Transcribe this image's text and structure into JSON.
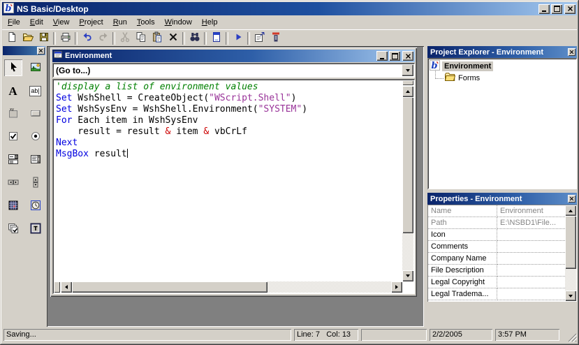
{
  "window": {
    "title": "NS Basic/Desktop",
    "logo_icon": "nsbasic-b-logo",
    "controls": [
      "minimize",
      "maximize",
      "close"
    ]
  },
  "menu": {
    "items": [
      {
        "label": "File",
        "u": 0
      },
      {
        "label": "Edit",
        "u": 0
      },
      {
        "label": "View",
        "u": 0
      },
      {
        "label": "Project",
        "u": 0
      },
      {
        "label": "Run",
        "u": 0
      },
      {
        "label": "Tools",
        "u": 0
      },
      {
        "label": "Window",
        "u": 0
      },
      {
        "label": "Help",
        "u": 0
      }
    ]
  },
  "toolbar": {
    "items": [
      {
        "name": "new",
        "enabled": true
      },
      {
        "name": "open",
        "enabled": true
      },
      {
        "name": "save",
        "enabled": true
      },
      {
        "sep": true
      },
      {
        "name": "print",
        "enabled": true
      },
      {
        "sep": true
      },
      {
        "name": "undo",
        "enabled": true
      },
      {
        "name": "redo",
        "enabled": false
      },
      {
        "sep": true
      },
      {
        "name": "cut",
        "enabled": false
      },
      {
        "name": "copy",
        "enabled": true
      },
      {
        "name": "paste",
        "enabled": true
      },
      {
        "name": "delete",
        "enabled": true
      },
      {
        "sep": true
      },
      {
        "name": "find",
        "enabled": true
      },
      {
        "sep": true
      },
      {
        "name": "deploy",
        "enabled": true
      },
      {
        "sep": true
      },
      {
        "name": "run",
        "enabled": true
      },
      {
        "sep": true
      },
      {
        "name": "properties",
        "enabled": true
      },
      {
        "name": "project-properties",
        "enabled": true
      }
    ]
  },
  "toolbox": {
    "selected": "pointer",
    "tools": [
      "pointer",
      "picture",
      "label",
      "textbox",
      "frame",
      "button",
      "checkbox",
      "option",
      "combobox",
      "listbox",
      "hscroll",
      "vscroll",
      "grid",
      "timer",
      "checklist",
      "form"
    ]
  },
  "editor": {
    "title": "Environment",
    "goto": "(Go to...)",
    "code_lines": [
      [
        [
          "com",
          "'display a list of environment values"
        ]
      ],
      [
        [
          "kw",
          "Set"
        ],
        [
          "pl",
          " WshShell = CreateObject("
        ],
        [
          "str",
          "\"WScript.Shell\""
        ],
        [
          "pl",
          ")"
        ]
      ],
      [
        [
          "kw",
          "Set"
        ],
        [
          "pl",
          " WshSysEnv = WshShell.Environment("
        ],
        [
          "str",
          "\"SYSTEM\""
        ],
        [
          "pl",
          ")"
        ]
      ],
      [
        [
          "kw",
          "For"
        ],
        [
          "pl",
          " Each item in WshSysEnv"
        ]
      ],
      [
        [
          "pl",
          "    result = result "
        ],
        [
          "op",
          "&"
        ],
        [
          "pl",
          " item "
        ],
        [
          "op",
          "&"
        ],
        [
          "pl",
          " vbCrLf"
        ]
      ],
      [
        [
          "kw",
          "Next"
        ]
      ],
      [
        [
          "kw",
          "MsgBox"
        ],
        [
          "pl",
          " result"
        ],
        [
          "cursor",
          ""
        ]
      ]
    ]
  },
  "project_explorer": {
    "title": "Project Explorer - Environment",
    "root": {
      "label": "Environment",
      "icon": "nsbasic-b-logo"
    },
    "children": [
      {
        "label": "Forms",
        "icon": "folder-icon"
      }
    ]
  },
  "properties": {
    "title": "Properties - Environment",
    "rows": [
      [
        "Name",
        "Environment",
        true
      ],
      [
        "Path",
        "E:\\NSBD1\\File...",
        true
      ],
      [
        "Icon",
        "",
        false
      ],
      [
        "Comments",
        "",
        false
      ],
      [
        "Company Name",
        "",
        false
      ],
      [
        "File Description",
        "",
        false
      ],
      [
        "Legal Copyright",
        "",
        false
      ],
      [
        "Legal Tradema...",
        "",
        false
      ]
    ]
  },
  "statusbar": {
    "panels": [
      {
        "name": "status-message",
        "text": "Saving..."
      },
      {
        "name": "line-col",
        "text": "Line: 7   Col: 13"
      },
      {
        "name": "spare",
        "text": ""
      },
      {
        "name": "date",
        "text": "2/2/2005"
      },
      {
        "name": "time",
        "text": "3:57 PM"
      }
    ]
  },
  "colors": {
    "title_gradient_start": "#0A246A",
    "title_gradient_end": "#A6CAF0",
    "chrome": "#D4D0C8",
    "mdi_background": "#808080",
    "code_keyword": "#0000E0",
    "code_comment": "#008000",
    "code_string": "#993399",
    "code_operator": "#CC0000"
  }
}
